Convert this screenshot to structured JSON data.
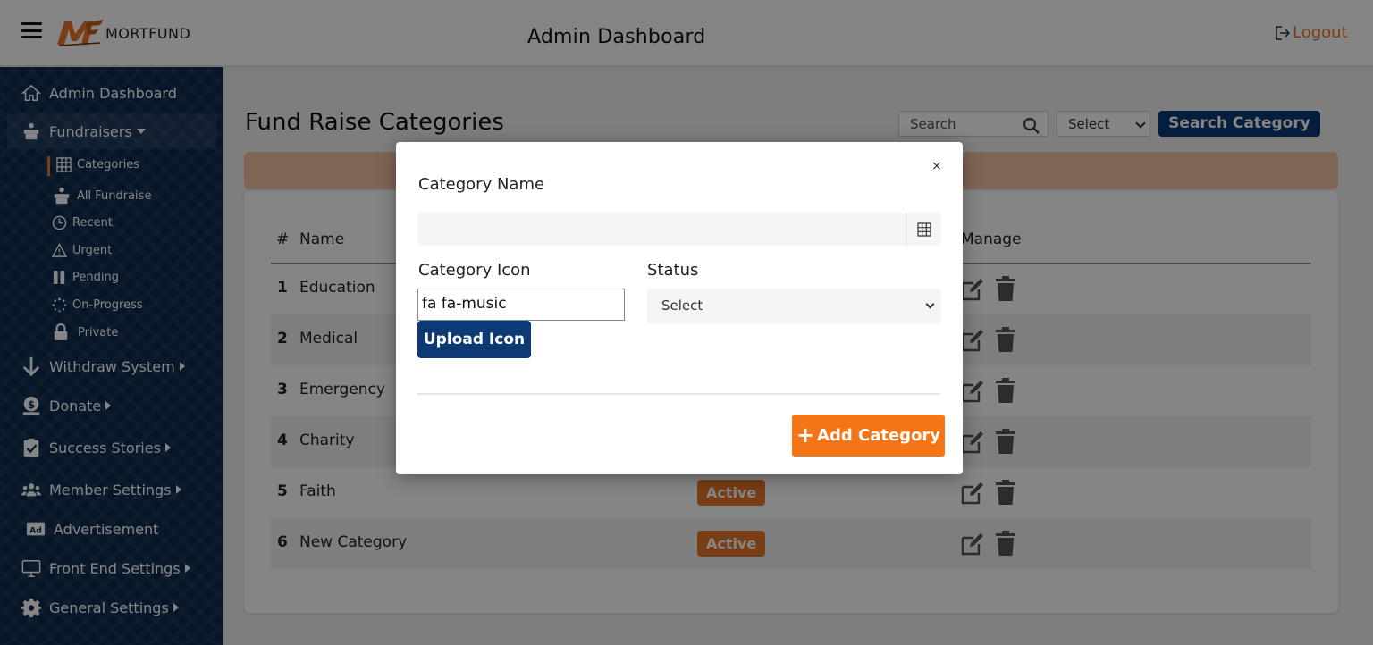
{
  "header": {
    "brand": "MORTFUND",
    "title": "Admin Dashboard",
    "logout": "Logout"
  },
  "sidebar": {
    "items": [
      {
        "label": "Admin Dashboard",
        "icon": "home-icon"
      },
      {
        "label": "Fundraisers",
        "icon": "donate-box-icon"
      },
      {
        "label": "Withdraw System",
        "icon": "arrow-down-icon"
      },
      {
        "label": "Donate",
        "icon": "dollar-coin-icon"
      },
      {
        "label": "Success Stories",
        "icon": "clipboard-check-icon"
      },
      {
        "label": "Member Settings",
        "icon": "users-icon"
      },
      {
        "label": "Advertisement",
        "icon": "ad-icon"
      },
      {
        "label": "Front End Settings",
        "icon": "monitor-icon"
      },
      {
        "label": "General Settings",
        "icon": "gear-icon"
      }
    ],
    "subitems": [
      {
        "label": "Categories",
        "icon": "table-icon"
      },
      {
        "label": "All Fundraise",
        "icon": "donate-box-icon"
      },
      {
        "label": "Recent",
        "icon": "clock-icon"
      },
      {
        "label": "Urgent",
        "icon": "warning-icon"
      },
      {
        "label": "Pending",
        "icon": "pause-icon"
      },
      {
        "label": "On-Progress",
        "icon": "spinner-icon"
      },
      {
        "label": "Private",
        "icon": "lock-icon"
      }
    ]
  },
  "main": {
    "page_title": "Fund Raise Categories",
    "search_placeholder": "Search",
    "filter_value": "Select",
    "search_button": "Search Category",
    "columns": [
      "#",
      "Name",
      "Manage"
    ],
    "rows": [
      {
        "num": "1",
        "name": "Education",
        "status": ""
      },
      {
        "num": "2",
        "name": "Medical",
        "status": ""
      },
      {
        "num": "3",
        "name": "Emergency",
        "status": ""
      },
      {
        "num": "4",
        "name": "Charity",
        "status": ""
      },
      {
        "num": "5",
        "name": "Faith",
        "status": "Active"
      },
      {
        "num": "6",
        "name": "New Category",
        "status": "Active"
      }
    ]
  },
  "modal": {
    "close": "×",
    "category_name_label": "Category Name",
    "category_name_value": "",
    "category_icon_label": "Category Icon",
    "category_icon_value": "fa fa-music",
    "status_label": "Status",
    "status_value": "Select",
    "upload_button": "Upload Icon",
    "add_button": "Add Category"
  },
  "colors": {
    "sidebar": "#0d2b4e",
    "accent": "#e8782a",
    "primary": "#0d3a75",
    "add_button": "#f47416",
    "alert": "#f4c1a3"
  }
}
